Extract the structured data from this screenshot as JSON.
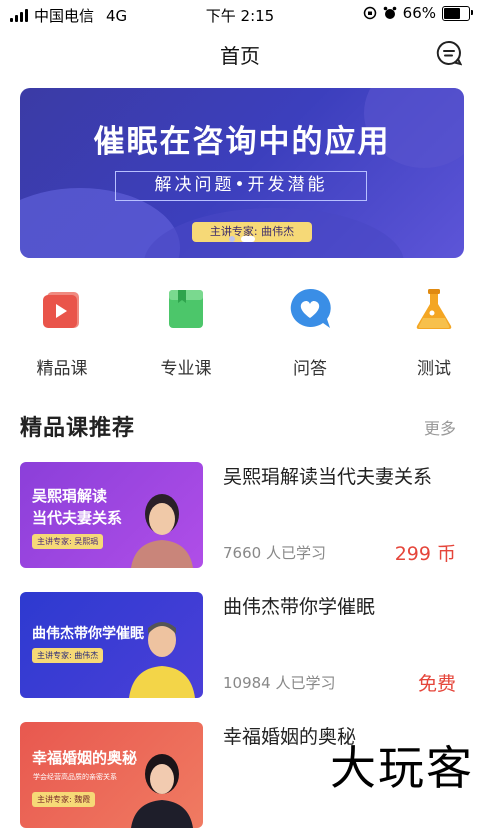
{
  "status_bar": {
    "carrier": "中国电信",
    "network": "4G",
    "time": "下午 2:15",
    "battery": "66%",
    "battery_level": 0.66
  },
  "header": {
    "title": "首页",
    "message_icon": "chat-bubble-icon"
  },
  "banner": {
    "headline": "催眠在咨询中的应用",
    "subtitle": "解决问题•开发潜能",
    "expert": "主讲专家: 曲伟杰",
    "page_count": 2,
    "active_page": 2
  },
  "categories": [
    {
      "label": "精品课",
      "icon": "video-play-icon",
      "color": "#e9544a"
    },
    {
      "label": "专业课",
      "icon": "book-icon",
      "color": "#4cc66a"
    },
    {
      "label": "问答",
      "icon": "heart-chat-icon",
      "color": "#3a8ee6"
    },
    {
      "label": "测试",
      "icon": "flask-icon",
      "color": "#f4a623"
    }
  ],
  "recommend": {
    "title": "精品课推荐",
    "more": "更多",
    "courses": [
      {
        "title": "吴熙琄解读当代夫妻关系",
        "thumb_title_1": "吴熙琄解读",
        "thumb_title_2": "当代夫妻关系",
        "thumb_expert": "主讲专家: 吴熙琄",
        "learners": "7660 人已学习",
        "price": "299 币"
      },
      {
        "title": "曲伟杰带你学催眠",
        "thumb_title_1": "曲伟杰带你学催眠",
        "thumb_expert": "主讲专家: 曲伟杰",
        "learners": "10984 人已学习",
        "price": "免费"
      },
      {
        "title": "幸福婚姻的奥秘",
        "thumb_title_1": "幸福婚姻的奥秘",
        "thumb_subtitle": "学会经营高品质的亲密关系",
        "thumb_expert": "主讲专家: 魏霞"
      }
    ]
  },
  "watermark": "大玩客",
  "colors": {
    "price": "#e5453a",
    "banner": "#3c3fbd"
  }
}
